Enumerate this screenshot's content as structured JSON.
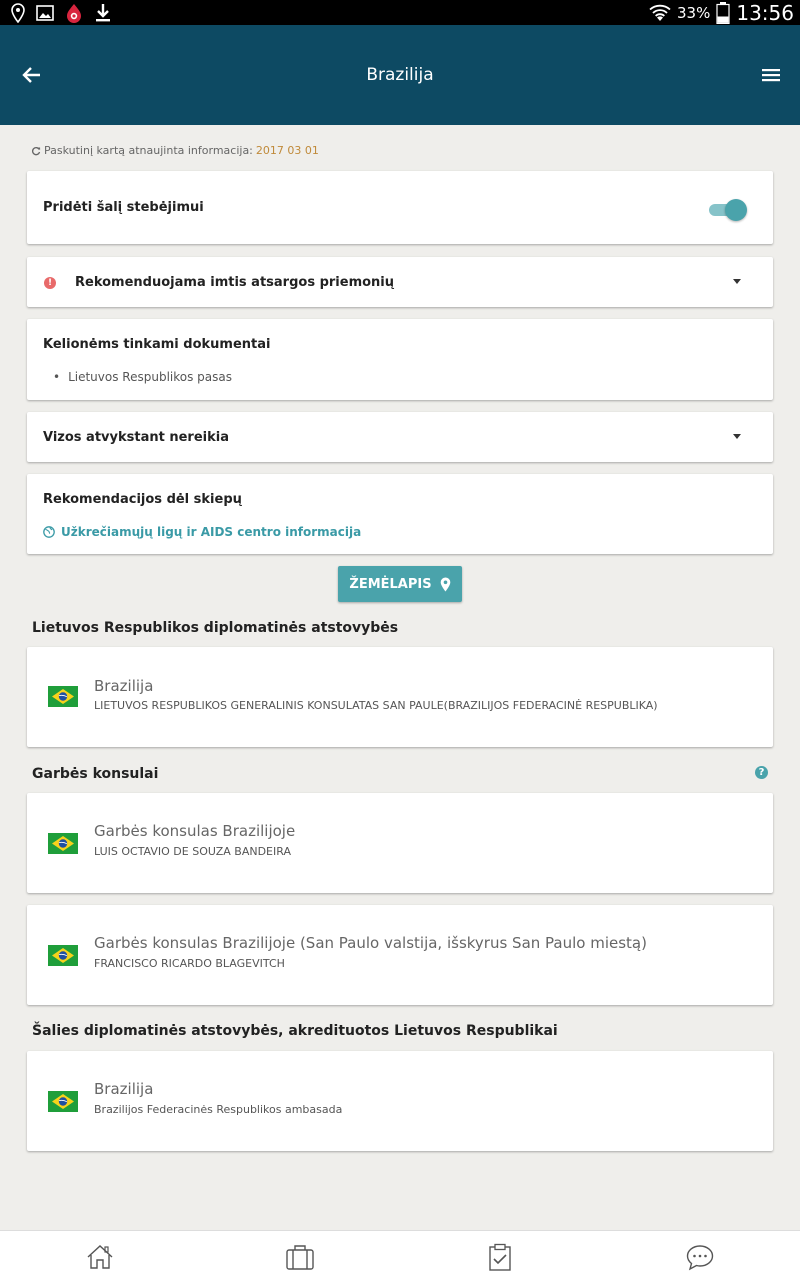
{
  "status_bar": {
    "battery_percent": "33%",
    "time": "13:56"
  },
  "appbar": {
    "title": "Brazilija"
  },
  "updated": {
    "label": "Paskutinį kartą atnaujinta informacija:",
    "date": "2017 03 01"
  },
  "cards": {
    "watch": {
      "label": "Pridėti šalį stebėjimui",
      "enabled": true
    },
    "advice": {
      "label": "Rekomenduojama imtis atsargos priemonių"
    },
    "documents": {
      "label": "Kelionėms tinkami dokumentai",
      "items": [
        "Lietuvos Respublikos pasas"
      ]
    },
    "visa": {
      "label": "Vizos atvykstant nereikia"
    },
    "vaccines": {
      "label": "Rekomendacijos dėl skiepų",
      "link": "Užkrečiamųjų ligų ir AIDS centro informacija"
    }
  },
  "map_button": {
    "label": "ŽEMĖLAPIS"
  },
  "sections": {
    "diplomatic": {
      "heading": "Lietuvos Respublikos diplomatinės atstovybės",
      "entries": [
        {
          "title": "Brazilija",
          "subtitle": "LIETUVOS RESPUBLIKOS GENERALINIS KONSULATAS SAN PAULE(BRAZILIJOS FEDERACINĖ RESPUBLIKA)"
        }
      ]
    },
    "honorary": {
      "heading": "Garbės konsulai",
      "entries": [
        {
          "title": "Garbės konsulas Brazilijoje",
          "subtitle": "LUIS OCTAVIO DE SOUZA BANDEIRA"
        },
        {
          "title": "Garbės konsulas Brazilijoje (San Paulo valstija, išskyrus San Paulo miestą)",
          "subtitle": "FRANCISCO RICARDO BLAGEVITCH"
        }
      ]
    },
    "accredited": {
      "heading": "Šalies diplomatinės atstovybės, akredituotos Lietuvos Respublikai",
      "entries": [
        {
          "title": "Brazilija",
          "subtitle": "Brazilijos Federacinės Respublikos ambasada"
        }
      ]
    }
  },
  "colors": {
    "appbar": "#0d4a63",
    "accent": "#4aa3ab",
    "warning": "#e86a6a",
    "date": "#c08a3a"
  }
}
